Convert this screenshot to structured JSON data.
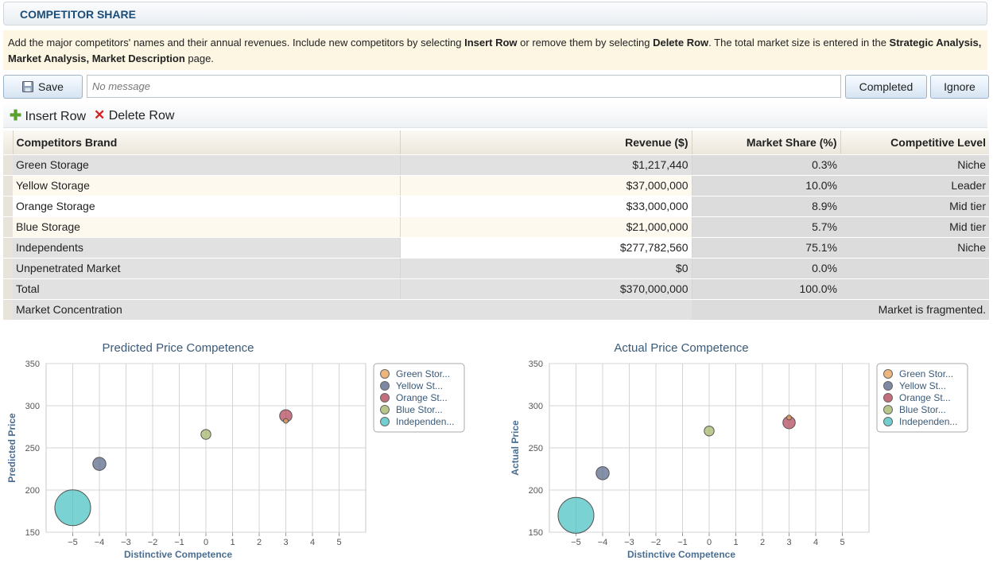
{
  "header": {
    "title": "COMPETITOR SHARE"
  },
  "info": {
    "t1": "Add the major competitors' names and their annual revenues. Include new competitors by selecting ",
    "b1": "Insert Row",
    "t2": " or remove them by selecting ",
    "b2": "Delete Row",
    "t3": ". The total market size is entered in the ",
    "b3": "Strategic Analysis, Market Analysis, Market Description",
    "t4": " page."
  },
  "actions": {
    "save": "Save",
    "message_placeholder": "No message",
    "completed": "Completed",
    "ignore": "Ignore"
  },
  "toolbar": {
    "insert_row": "Insert Row",
    "delete_row": "Delete Row"
  },
  "colors": {
    "green": "#E8A45C",
    "yellow": "#5C6B8C",
    "orange": "#B44A5C",
    "blue": "#A5B86C",
    "independents": "#4DC3C3"
  },
  "table": {
    "headers": [
      "Competitors Brand",
      "Revenue ($)",
      "Market Share (%)",
      "Competitive Level"
    ],
    "rows": [
      {
        "brand": "Green Storage",
        "revenue": "$1,217,440",
        "share": "0.3%",
        "level": "Niche"
      },
      {
        "brand": "Yellow Storage",
        "revenue": "$37,000,000",
        "share": "10.0%",
        "level": "Leader"
      },
      {
        "brand": "Orange Storage",
        "revenue": "$33,000,000",
        "share": "8.9%",
        "level": "Mid tier"
      },
      {
        "brand": "Blue Storage",
        "revenue": "$21,000,000",
        "share": "5.7%",
        "level": "Mid tier"
      },
      {
        "brand": "Independents",
        "revenue": "$277,782,560",
        "share": "75.1%",
        "level": "Niche"
      },
      {
        "brand": "Unpenetrated Market",
        "revenue": "$0",
        "share": "0.0%",
        "level": ""
      },
      {
        "brand": "Total",
        "revenue": "$370,000,000",
        "share": "100.0%",
        "level": ""
      }
    ],
    "concentration": {
      "label": "Market Concentration",
      "value": "Market is fragmented."
    }
  },
  "chart_data": [
    {
      "type": "scatter",
      "title": "Predicted Price Competence",
      "xlabel": "Distinctive Competence",
      "ylabel": "Predicted Price",
      "xlim": [
        -6,
        6
      ],
      "ylim": [
        150,
        350
      ],
      "xticks": [
        -5,
        -4,
        -3,
        -2,
        -1,
        0,
        1,
        2,
        3,
        4,
        5
      ],
      "yticks": [
        150,
        200,
        250,
        300,
        350
      ],
      "legend": [
        "Green Stor...",
        "Yellow St...",
        "Orange St...",
        "Blue Stor...",
        "Independen..."
      ],
      "series": [
        {
          "name": "Green Stor...",
          "x": 3,
          "y": 282,
          "share": 0.3
        },
        {
          "name": "Yellow St...",
          "x": -4,
          "y": 231,
          "share": 10.0
        },
        {
          "name": "Orange St...",
          "x": 3,
          "y": 288,
          "share": 8.9
        },
        {
          "name": "Blue Stor...",
          "x": 0,
          "y": 266,
          "share": 5.7
        },
        {
          "name": "Independen...",
          "x": -5,
          "y": 179,
          "share": 75.1
        }
      ]
    },
    {
      "type": "scatter",
      "title": "Actual Price Competence",
      "xlabel": "Distinctive Competence",
      "ylabel": "Actual Price",
      "xlim": [
        -6,
        6
      ],
      "ylim": [
        150,
        350
      ],
      "xticks": [
        -5,
        -4,
        -3,
        -2,
        -1,
        0,
        1,
        2,
        3,
        4,
        5
      ],
      "yticks": [
        150,
        200,
        250,
        300,
        350
      ],
      "legend": [
        "Green Stor...",
        "Yellow St...",
        "Orange St...",
        "Blue Stor...",
        "Independen..."
      ],
      "series": [
        {
          "name": "Green Stor...",
          "x": 3,
          "y": 286,
          "share": 0.3
        },
        {
          "name": "Yellow St...",
          "x": -4,
          "y": 220,
          "share": 10.0
        },
        {
          "name": "Orange St...",
          "x": 3,
          "y": 280,
          "share": 8.9
        },
        {
          "name": "Blue Stor...",
          "x": 0,
          "y": 270,
          "share": 5.7
        },
        {
          "name": "Independen...",
          "x": -5,
          "y": 170,
          "share": 75.1
        }
      ]
    }
  ]
}
